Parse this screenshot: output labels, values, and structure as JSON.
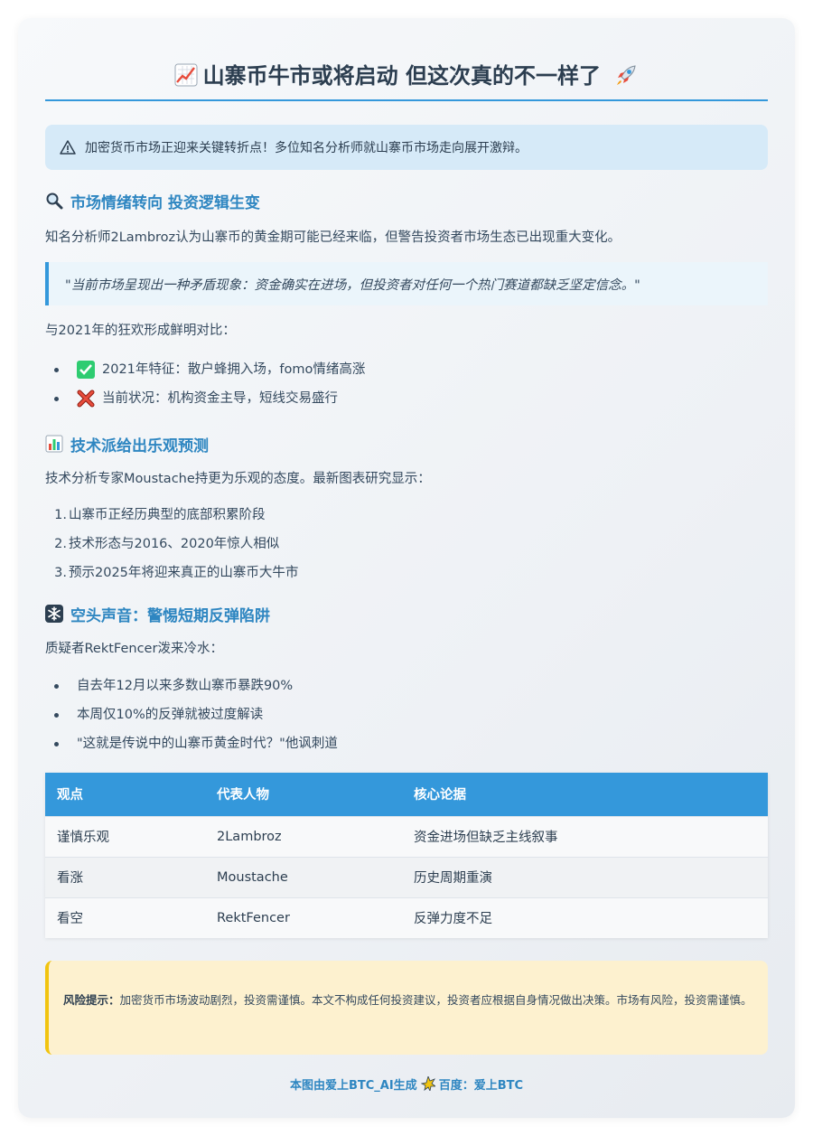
{
  "header": {
    "title": "山寨币牛市或将启动 但这次真的不一样了",
    "title_left_icon": "chart-increasing-icon",
    "title_right_icon": "rocket-icon"
  },
  "alert": {
    "icon": "warning-icon",
    "text": "加密货币市场正迎来关键转折点！多位知名分析师就山寨币市场走向展开激辩。"
  },
  "section1": {
    "icon": "magnifier-icon",
    "heading": "市场情绪转向 投资逻辑生变",
    "paragraph": "知名分析师2Lambroz认为山寨币的黄金期可能已经来临，但警告投资者市场生态已出现重大变化。",
    "quote": "\"当前市场呈现出一种矛盾现象：资金确实在进场，但投资者对任何一个热门赛道都缺乏坚定信念。\"",
    "compare_intro": "与2021年的狂欢形成鲜明对比：",
    "compare": [
      {
        "icon": "check-mark-icon",
        "text": "2021年特征：散户蜂拥入场，fomo情绪高涨"
      },
      {
        "icon": "cross-mark-icon",
        "text": "当前状况：机构资金主导，短线交易盛行"
      }
    ]
  },
  "section2": {
    "icon": "bar-chart-icon",
    "heading": "技术派给出乐观预测",
    "paragraph": "技术分析专家Moustache持更为乐观的态度。最新图表研究显示：",
    "items": [
      {
        "num": "1.",
        "text": "山寨币正经历典型的底部积累阶段"
      },
      {
        "num": "2.",
        "text": "技术形态与2016、2020年惊人相似"
      },
      {
        "num": "3.",
        "text": "预示2025年将迎来真正的山寨币大牛市"
      }
    ]
  },
  "section3": {
    "icon": "snowflake-icon",
    "heading": "空头声音：警惕短期反弹陷阱",
    "paragraph": "质疑者RektFencer泼来冷水：",
    "items": [
      "自去年12月以来多数山寨币暴跌90%",
      "本周仅10%的反弹就被过度解读",
      "\"这就是传说中的山寨币黄金时代？\"他讽刺道"
    ]
  },
  "table": {
    "headers": [
      "观点",
      "代表人物",
      "核心论据"
    ],
    "rows": [
      [
        "谨慎乐观",
        "2Lambroz",
        "资金进场但缺乏主线叙事"
      ],
      [
        "看涨",
        "Moustache",
        "历史周期重演"
      ],
      [
        "看空",
        "RektFencer",
        "反弹力度不足"
      ]
    ]
  },
  "risk": {
    "label": "风险提示：",
    "text": "加密货币市场波动剧烈，投资需谨慎。本文不构成任何投资建议，投资者应根据自身情况做出决策。市场有风险，投资需谨慎。"
  },
  "footer": {
    "left": "本图由爱上BTC_AI生成",
    "icon": "sparkle-icon",
    "right": "百度：爱上BTC"
  },
  "colors": {
    "accent": "#3498db",
    "heading": "#2e86c1",
    "alert_bg": "#d6eaf8",
    "risk_bg": "#fdf1cf",
    "risk_border": "#f1c40f"
  }
}
